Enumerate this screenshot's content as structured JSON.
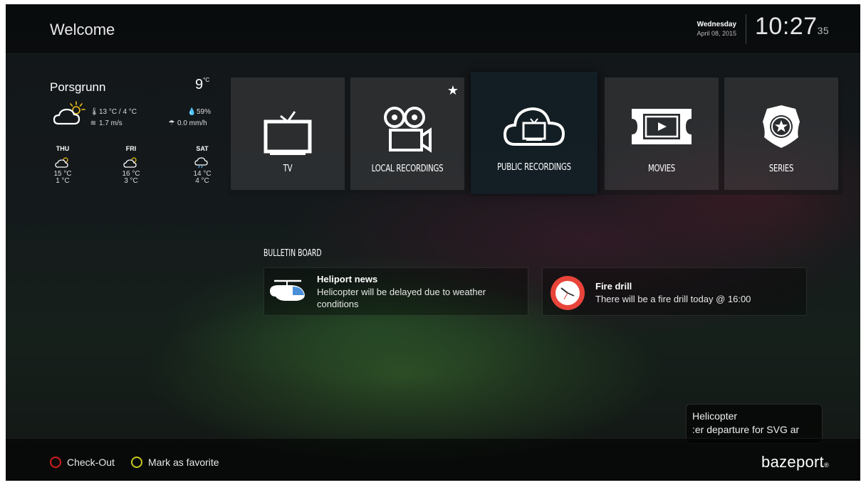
{
  "header": {
    "title": "Welcome",
    "day": "Wednesday",
    "date": "April 08, 2015",
    "time": "10:27",
    "seconds": "35"
  },
  "weather": {
    "city": "Porsgrunn",
    "temp": "9",
    "temp_unit": "°C",
    "hi_lo": "13 °C / 4 °C",
    "wind": "1.7 m/s",
    "humidity": "59%",
    "precip": "0.0 mm/h",
    "current_icon": "partly-cloudy-icon",
    "forecast": [
      {
        "day": "THU",
        "high": "15 °C",
        "low": "1 °C",
        "icon": "partly-cloudy-icon"
      },
      {
        "day": "FRI",
        "high": "16 °C",
        "low": "3 °C",
        "icon": "partly-cloudy-icon"
      },
      {
        "day": "SAT",
        "high": "14 °C",
        "low": "4 °C",
        "icon": "rain-cloud-icon"
      }
    ]
  },
  "tiles": [
    {
      "label": "TV",
      "icon": "tv-icon"
    },
    {
      "label": "LOCAL RECORDINGS",
      "icon": "camera-icon",
      "favorite": true
    },
    {
      "label": "PUBLIC RECORDINGS",
      "icon": "cloud-tv-icon",
      "selected": true
    },
    {
      "label": "MOVIES",
      "icon": "ticket-icon"
    },
    {
      "label": "SERIES",
      "icon": "badge-icon"
    }
  ],
  "bulletin": {
    "title": "BULLETIN BOARD",
    "items": [
      {
        "title": "Heliport news",
        "text": "Helicopter will be delayed due to weather conditions",
        "icon": "helicopter-icon"
      },
      {
        "title": "Fire drill",
        "text": "There will be a fire drill today @ 16:00",
        "icon": "clock-icon",
        "icon_color": "#e8443a"
      }
    ]
  },
  "popup": {
    "title": "Helicopter",
    "text": ":er departure for SVG ar"
  },
  "footer": {
    "checkout_label": "Check-Out",
    "checkout_color": "#d21f1f",
    "favorite_label": "Mark as favorite",
    "favorite_color": "#c8c81e",
    "brand": "bazeport"
  }
}
